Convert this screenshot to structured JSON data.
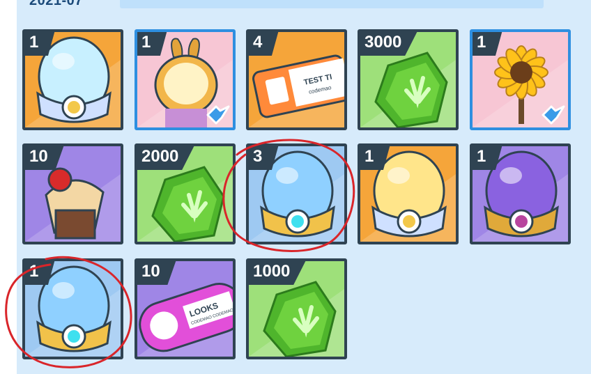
{
  "header": {
    "date": "2021-07"
  },
  "items": [
    {
      "count": "1",
      "art": "egg-rainbow",
      "bg": "orange",
      "rare": false
    },
    {
      "count": "1",
      "art": "suit-bunny",
      "bg": "pink",
      "rare": true
    },
    {
      "count": "4",
      "art": "ticket",
      "bg": "orange",
      "rare": false,
      "text": "TEST TI",
      "sub": "codemao"
    },
    {
      "count": "3000",
      "art": "gem",
      "bg": "green",
      "rare": false
    },
    {
      "count": "1",
      "art": "sunflower",
      "bg": "pink",
      "rare": true
    },
    {
      "count": "10",
      "art": "cupcake",
      "bg": "purple",
      "rare": false
    },
    {
      "count": "2000",
      "art": "gem",
      "bg": "green",
      "rare": false
    },
    {
      "count": "3",
      "art": "egg-blue",
      "bg": "blue",
      "rare": false
    },
    {
      "count": "1",
      "art": "egg-gold",
      "bg": "orange",
      "rare": false
    },
    {
      "count": "1",
      "art": "egg-purple",
      "bg": "purple",
      "rare": false
    },
    {
      "count": "1",
      "art": "egg-blue",
      "bg": "blue",
      "rare": false
    },
    {
      "count": "10",
      "art": "looks-ticket",
      "bg": "purple",
      "rare": false,
      "text": "LOOKS",
      "sub": "CODEMAO CODEMAO"
    },
    {
      "count": "1000",
      "art": "gem",
      "bg": "green",
      "rare": false
    }
  ],
  "colors": {
    "orange": "#f5a53a",
    "pink": "#f7c6d4",
    "green": "#9ee07a",
    "purple": "#9f86e6",
    "blue": "#9ec9f2",
    "annotation": "#d9252a"
  }
}
